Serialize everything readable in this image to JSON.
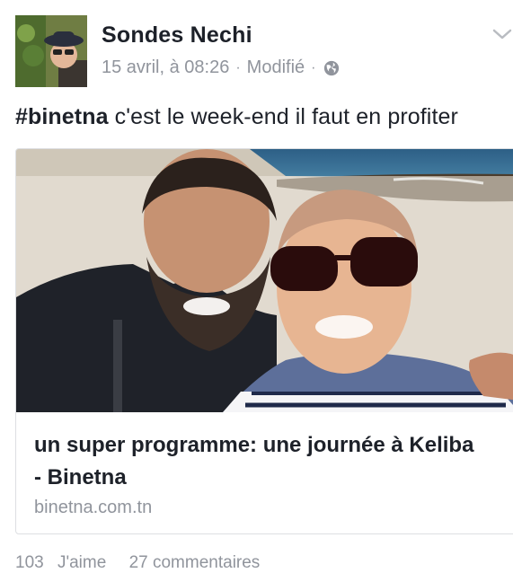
{
  "post": {
    "author": "Sondes Nechi",
    "timestamp": "15 avril, à 08:26",
    "separator": "·",
    "edited_label": "Modifié",
    "privacy_icon": "globe-icon",
    "menu_icon": "chevron-down-icon",
    "hashtag": "#binetna",
    "status_text": " c'est le week-end il faut en profiter"
  },
  "link_card": {
    "title": "un super programme: une journée à Keliba - Binetna",
    "domain": "binetna.com.tn"
  },
  "reactions": {
    "likes": "103",
    "likes_label": "J'aime",
    "comments": "27 commentaires"
  },
  "colors": {
    "text": "#1d2129",
    "meta": "#90949c",
    "border": "#dddfe2"
  }
}
